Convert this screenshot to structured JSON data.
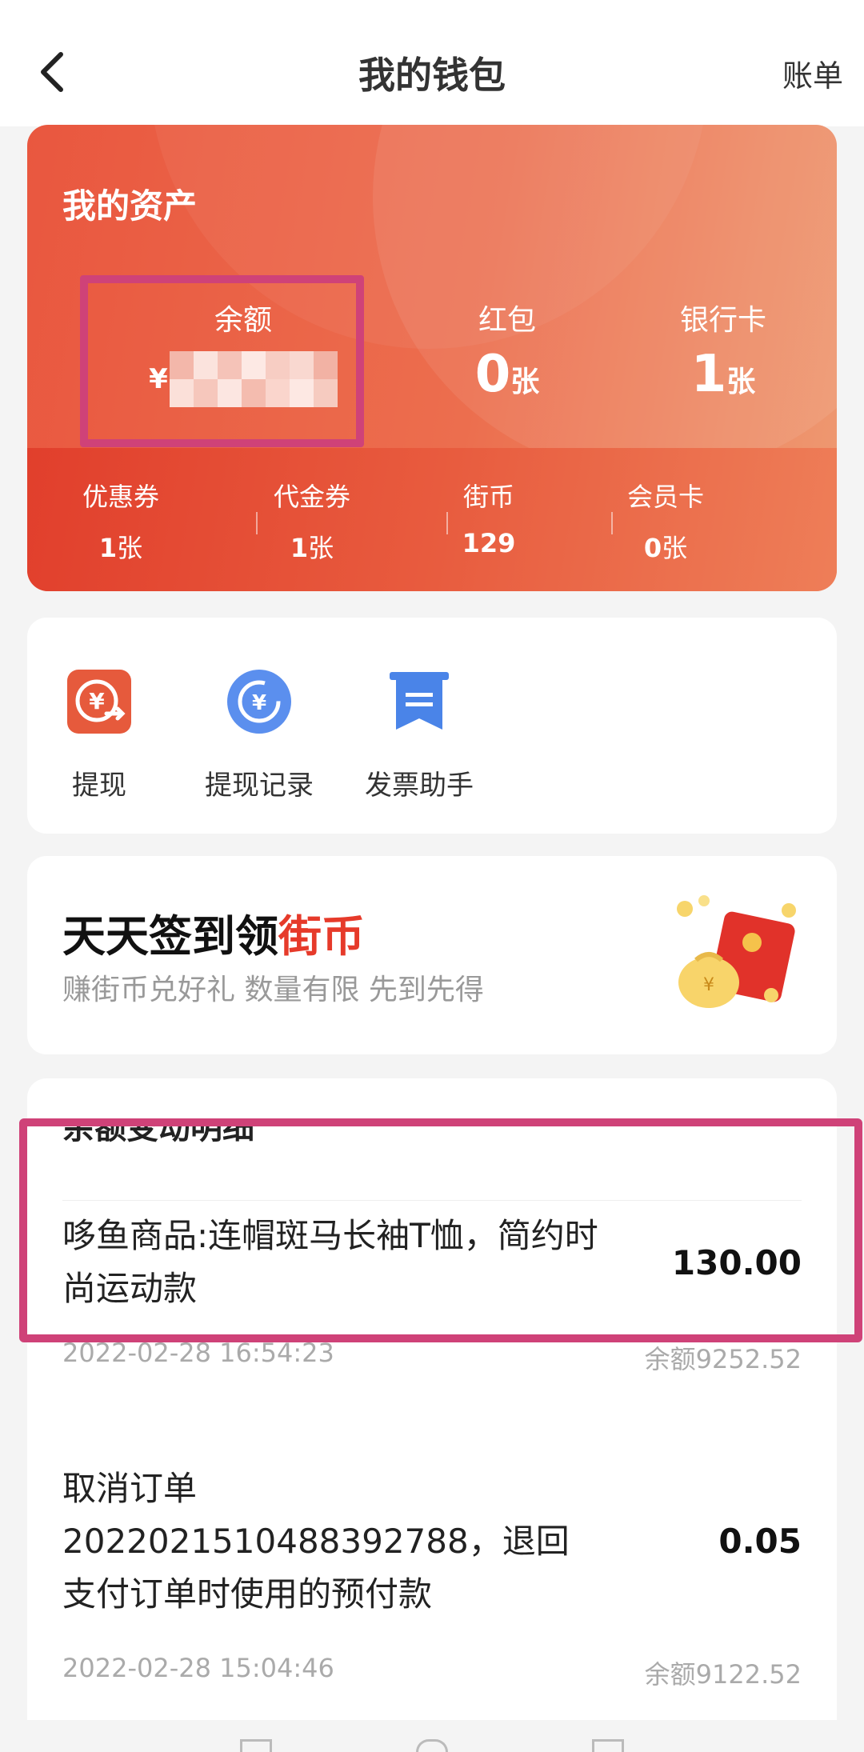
{
  "header": {
    "title": "我的钱包",
    "bill_label": "账单"
  },
  "assets": {
    "title": "我的资产",
    "balance": {
      "label": "余额",
      "currency": "¥",
      "value_obscured": true
    },
    "red_packet": {
      "label": "红包",
      "value": "0",
      "unit": "张"
    },
    "bank_card": {
      "label": "银行卡",
      "value": "1",
      "unit": "张"
    },
    "mini": [
      {
        "label": "优惠券",
        "value": "1",
        "unit": "张"
      },
      {
        "label": "代金券",
        "value": "1",
        "unit": "张"
      },
      {
        "label": "街币",
        "value": "129",
        "unit": ""
      },
      {
        "label": "会员卡",
        "value": "0",
        "unit": "张"
      }
    ]
  },
  "tools": [
    {
      "label": "提现",
      "icon": "withdraw-icon"
    },
    {
      "label": "提现记录",
      "icon": "withdraw-history-icon"
    },
    {
      "label": "发票助手",
      "icon": "invoice-icon"
    }
  ],
  "signin": {
    "title_prefix": "天天签到领",
    "title_highlight": "街币",
    "subtitle": "赚街币兑好礼 数量有限 先到先得"
  },
  "details": {
    "header": "余额变动明细",
    "transactions": [
      {
        "title": "哆鱼商品:连帽斑马长袖T恤，简约时尚运动款",
        "amount": "130.00",
        "time": "2022-02-28 16:54:23",
        "balance": "余额9252.52"
      },
      {
        "title": "取消订单20220215104883927 88，退回支付订单时使用的预付款",
        "title_lines": [
          "取消订单",
          "20220215104883927​88，退回",
          "支付订单时使用的预付款"
        ],
        "amount": "0.05",
        "time": "2022-02-28 15:04:46",
        "balance": "余额9122.52"
      }
    ]
  },
  "colors": {
    "accent": "#e9573f",
    "highlight_border": "#cf4278",
    "link_red": "#e63a2a"
  }
}
